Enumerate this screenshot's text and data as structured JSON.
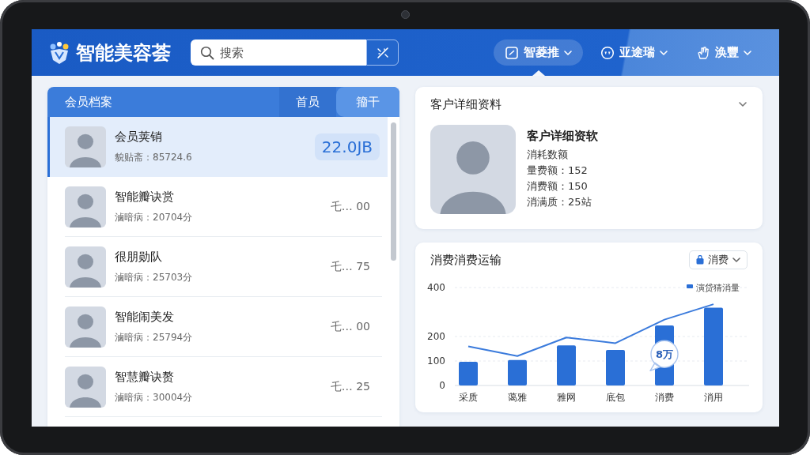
{
  "header": {
    "logo": "智能美容荟",
    "search": {
      "placeholder": "搜索"
    },
    "nav": [
      {
        "label": "智菱推",
        "selected": true
      },
      {
        "label": "亚途瑞",
        "selected": false
      },
      {
        "label": "涣豐",
        "selected": false
      }
    ]
  },
  "members": {
    "title": "会员档案",
    "tabs": [
      {
        "label": "首员",
        "selected": false
      },
      {
        "label": "籀干",
        "selected": true
      }
    ],
    "rows": [
      {
        "name": "会员荚销",
        "detail": "貌贴斋：85724.6",
        "value": "22.0JB",
        "selected": true
      },
      {
        "name": "智能瓣诀赏",
        "detail": "滷暗病：20704分",
        "value": "乇… 00",
        "selected": false
      },
      {
        "name": "很朋勋队",
        "detail": "滷暗病：25703分",
        "value": "乇… 75",
        "selected": false
      },
      {
        "name": "智能闹美发",
        "detail": "滷暗病：25794分",
        "value": "乇… 00",
        "selected": false
      },
      {
        "name": "智慧瓣诀赘",
        "detail": "滷暗病：30004分",
        "value": "乇… 25",
        "selected": false
      }
    ]
  },
  "detail": {
    "title": "客户详细资料",
    "name": "客户详细资软",
    "lines": [
      "消耗数额",
      "量费额：152",
      "消费额：150",
      "消满质：25站"
    ]
  },
  "trend": {
    "title": "消费消费运输",
    "filter": "消费",
    "chart_data": {
      "type": "bar",
      "categories": [
        "采质",
        "蔼雅",
        "雅网",
        "底包",
        "消费",
        "消用"
      ],
      "series": [
        {
          "name": "演贷猜消量",
          "color": "#2a6fd6",
          "values": [
            97,
            104,
            164,
            145,
            245,
            318
          ]
        },
        {
          "type": "line",
          "color": "#3b7bdc",
          "values": [
            160,
            120,
            196,
            173,
            269,
            332
          ]
        }
      ],
      "ylim": [
        0,
        400
      ],
      "yticks": [
        0,
        100,
        200,
        400
      ],
      "annotations": [
        {
          "text": "8万",
          "x": "消费",
          "y": 128
        }
      ]
    }
  }
}
